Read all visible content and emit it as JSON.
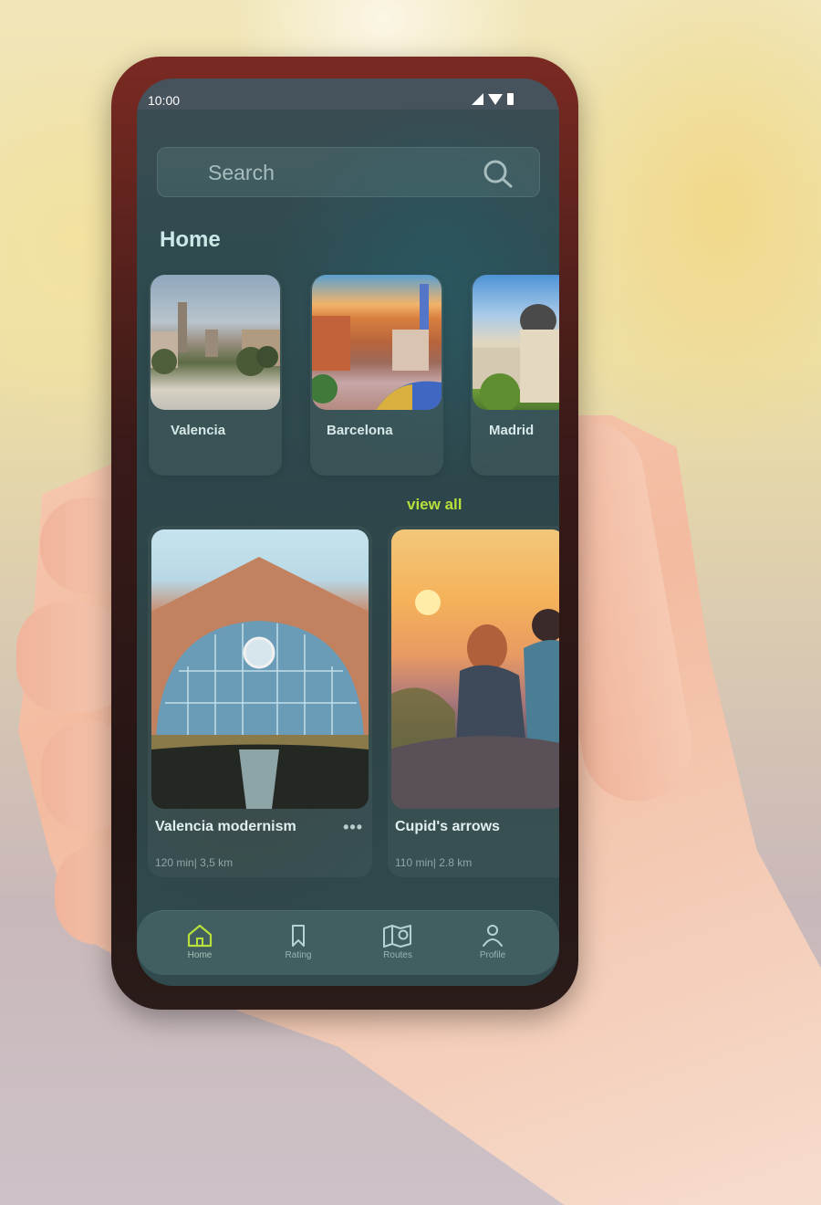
{
  "status_bar": {
    "time": "10:00",
    "icons": [
      "signal-icon",
      "wifi-icon",
      "battery-icon"
    ]
  },
  "search": {
    "placeholder": "Search",
    "icon": "search-icon"
  },
  "home": {
    "title": "Home",
    "cities": [
      {
        "name": "Valencia"
      },
      {
        "name": "Barcelona"
      },
      {
        "name": "Madrid"
      }
    ],
    "view_all": "view all",
    "routes": [
      {
        "title": "Valencia modernism",
        "duration": "120 min",
        "distance": "3,5 km",
        "meta": "120 min| 3,5 km",
        "has_more_menu": true
      },
      {
        "title": "Cupid's arrows",
        "duration": "110 min",
        "distance": "2.8 km",
        "meta": "110 min| 2.8 km",
        "has_more_menu": false
      }
    ]
  },
  "navbar": {
    "items": [
      {
        "label": "Home",
        "icon": "home-icon",
        "active": true
      },
      {
        "label": "Rating",
        "icon": "bookmark-icon",
        "active": false
      },
      {
        "label": "Routes",
        "icon": "map-icon",
        "active": false
      },
      {
        "label": "Profile",
        "icon": "profile-icon",
        "active": false
      }
    ]
  },
  "colors": {
    "accent": "#b8e03c",
    "text": "#d6e9e8",
    "muted": "#8fa6a6"
  }
}
